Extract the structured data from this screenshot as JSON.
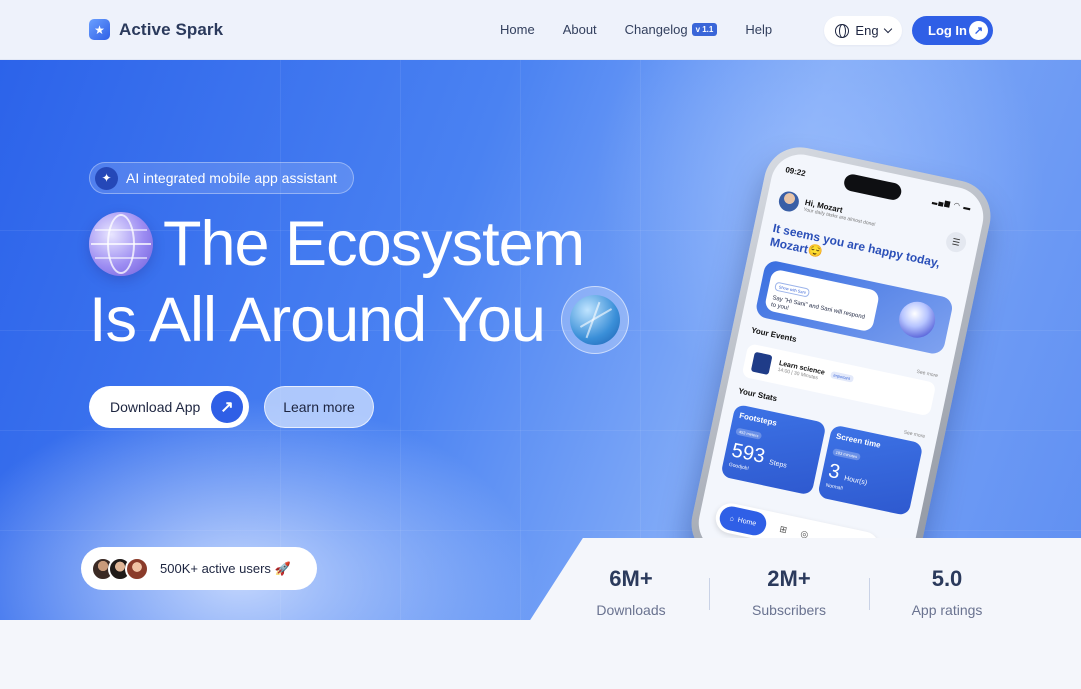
{
  "brand": {
    "name": "Active Spark",
    "logo_icon": "star-app-icon"
  },
  "nav": {
    "links": [
      "Home",
      "About",
      "Changelog",
      "Help"
    ],
    "changelog_badge": "v 1.1",
    "language": "Eng",
    "login_label": "Log In"
  },
  "hero": {
    "tag": "AI integrated mobile app assistant",
    "headline_line1": "The Ecosystem",
    "headline_line2": "Is All Around You",
    "download_label": "Download App",
    "learn_label": "Learn more",
    "users_label": "500K+ active users 🚀"
  },
  "phone": {
    "time": "09:22",
    "status_icons": "▂▄▆ ◠ ▬",
    "greeting": "Hi, Mozart",
    "greeting_sub": "Your daily tasks are almost done!",
    "mood": "It seems you are happy today, Mozart😌",
    "sani_tag": "Show with Sani",
    "sani_text": "Say \"Hi Sani\" and Sani will respond to you!",
    "events_title": "Your Events",
    "see_more": "See more",
    "event_name": "Learn science",
    "event_tag": "Important",
    "event_time": "14:00 | 30 Minutes",
    "stats_title": "Your Stats",
    "footsteps_title": "Footsteps",
    "footsteps_sub": "453 meters",
    "footsteps_value": "593",
    "footsteps_unit": "Steps",
    "footsteps_foot": "Goodjob!",
    "screen_title": "Screen time",
    "screen_sub": "183 minutes",
    "screen_value": "3",
    "screen_unit": "Hour(s)",
    "screen_foot": "Normal!",
    "tab_home": "Home"
  },
  "stats": [
    {
      "value": "6M+",
      "label": "Downloads"
    },
    {
      "value": "2M+",
      "label": "Subscribers"
    },
    {
      "value": "5.0",
      "label": "App ratings"
    }
  ],
  "colors": {
    "accent": "#2f5fe6",
    "text_dark": "#2b3a5c"
  }
}
